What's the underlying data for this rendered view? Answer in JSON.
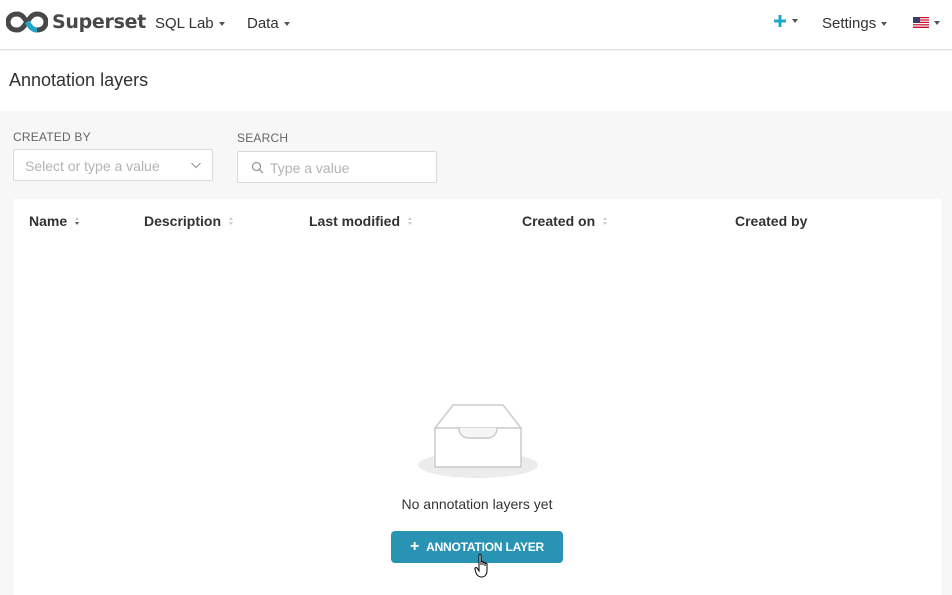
{
  "brand": {
    "name": "Superset"
  },
  "navbar": {
    "menus": [
      {
        "label": "SQL Lab"
      },
      {
        "label": "Data"
      }
    ],
    "settings_label": "Settings",
    "plus_icon": "plus-icon",
    "language_icon": "us-flag-icon",
    "accent_color": "#20a7c9"
  },
  "page": {
    "title": "Annotation layers"
  },
  "filters": {
    "created_by": {
      "label": "CREATED BY",
      "placeholder": "Select or type a value"
    },
    "search": {
      "label": "SEARCH",
      "placeholder": "Type a value"
    }
  },
  "table": {
    "columns": [
      {
        "label": "Name",
        "sortable": true,
        "sorted": true
      },
      {
        "label": "Description",
        "sortable": true
      },
      {
        "label": "Last modified",
        "sortable": true
      },
      {
        "label": "Created on",
        "sortable": true
      },
      {
        "label": "Created by",
        "sortable": false
      }
    ],
    "rows": []
  },
  "empty_state": {
    "icon": "empty-inbox-icon",
    "message": "No annotation layers yet",
    "button_label": "ANNOTATION LAYER"
  }
}
